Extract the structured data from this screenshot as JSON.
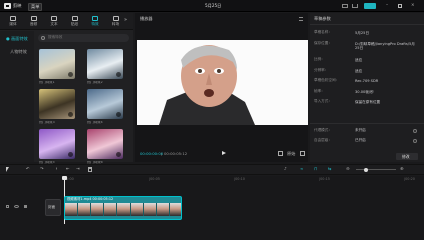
{
  "titlebar": {
    "app_name": "剪映",
    "menu_label": "菜单",
    "title": "5月25日"
  },
  "toolbar": {
    "tabs": [
      {
        "label": "媒体",
        "icon": "media-icon"
      },
      {
        "label": "音频",
        "icon": "audio-icon"
      },
      {
        "label": "文本",
        "icon": "text-icon"
      },
      {
        "label": "贴纸",
        "icon": "sticker-icon"
      },
      {
        "label": "特效",
        "icon": "effects-icon"
      },
      {
        "label": "转场",
        "icon": "transition-icon"
      }
    ],
    "active_tab": 4,
    "more_label": "»"
  },
  "sidebar": {
    "items": [
      "● 画面特效",
      "人物特效"
    ],
    "active_index": 0
  },
  "search": {
    "placeholder": "搜索特效"
  },
  "effects": [
    {
      "name": "热门特效1",
      "palette": [
        "#a6c2d8",
        "#d9d4c0",
        "#7d7a6a"
      ]
    },
    {
      "name": "热门特效2",
      "palette": [
        "#6f8aa0",
        "#e8eef2",
        "#3b4a57"
      ]
    },
    {
      "name": "热门特效3",
      "palette": [
        "#d6c27a",
        "#3d3424",
        "#a8957a"
      ]
    },
    {
      "name": "热门特效4",
      "palette": [
        "#4c6a8a",
        "#b7c9d8",
        "#2a3a4a"
      ]
    },
    {
      "name": "热门特效5",
      "palette": [
        "#8e58c6",
        "#d7b4f0",
        "#3a2a66"
      ]
    },
    {
      "name": "热门特效6",
      "palette": [
        "#a8436d",
        "#f0c7d6",
        "#4b2a5e"
      ]
    }
  ],
  "player": {
    "title": "播放器",
    "current_time": "00:00:00:00",
    "total_time": "00:00:05:12",
    "fullscreen_label": "原始"
  },
  "draft": {
    "title": "草稿参数",
    "rows": [
      {
        "key": "草稿名称：",
        "value": "5月25日"
      },
      {
        "key": "保存位置：",
        "value": "D:/剪映草稿/JianyingPro Drafts/5月25日"
      },
      {
        "key": "比例：",
        "value": "适应"
      },
      {
        "key": "分辨率：",
        "value": "适应"
      },
      {
        "key": "草稿色彩空间：",
        "value": "Rec.709 SDR"
      },
      {
        "key": "帧率：",
        "value": "30.00帧/秒"
      },
      {
        "key": "导入方式：",
        "value": "保留在原有位置"
      }
    ],
    "toggles": [
      {
        "key": "代理模式：",
        "value": "未开启"
      },
      {
        "key": "自由层级：",
        "value": "已开启"
      }
    ],
    "modify_label": "修改"
  },
  "timeline": {
    "ruler_marks": [
      "00:00",
      "|00:05",
      "|00:10",
      "|00:15",
      "|00:20"
    ],
    "track_label": "封面",
    "clip_label": "视频素材1.mp4  00:00:05:12",
    "colors": {
      "clip": "#1f8a94",
      "accent": "#00c1cd"
    }
  }
}
